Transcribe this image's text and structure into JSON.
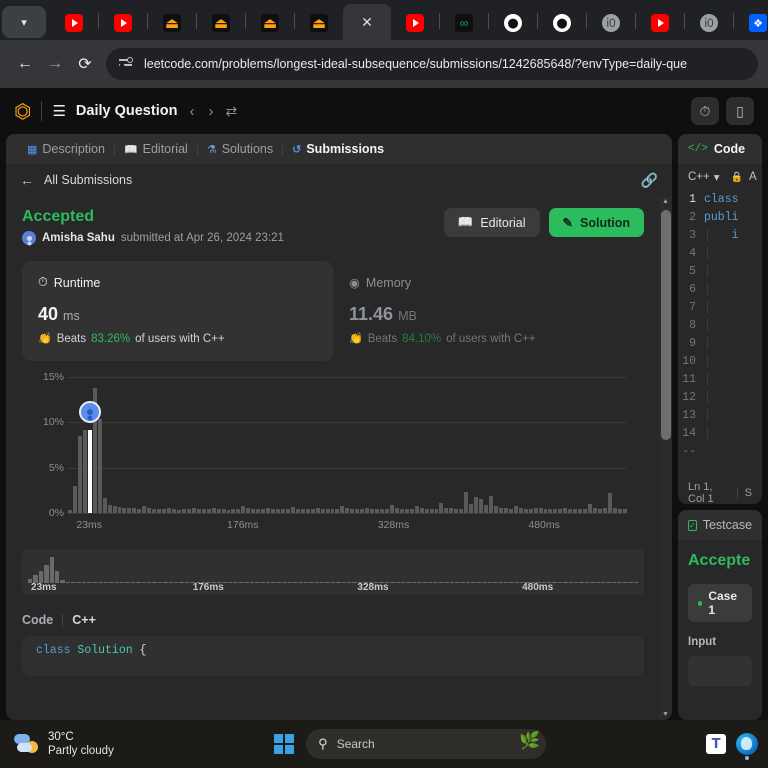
{
  "browser": {
    "tab_list_chevron_icon": "chevron-down-icon",
    "tabs": [
      {
        "favicon": "youtube-icon",
        "type": "yt",
        "active": false
      },
      {
        "favicon": "youtube-icon",
        "type": "yt",
        "active": false
      },
      {
        "favicon": "leetcode-icon",
        "type": "lc",
        "active": false
      },
      {
        "favicon": "leetcode-icon",
        "type": "lc",
        "active": false
      },
      {
        "favicon": "leetcode-icon",
        "type": "lc",
        "active": false
      },
      {
        "favicon": "leetcode-icon",
        "type": "lc",
        "active": false
      },
      {
        "favicon": "close-icon",
        "type": "active",
        "active": true
      },
      {
        "favicon": "youtube-icon",
        "type": "yt",
        "active": false
      },
      {
        "favicon": "mint-icon",
        "type": "teal",
        "active": false
      },
      {
        "favicon": "github-icon",
        "type": "gh",
        "active": false
      },
      {
        "favicon": "github-icon",
        "type": "gh",
        "active": false
      },
      {
        "favicon": "globe-icon",
        "type": "globe",
        "active": false
      },
      {
        "favicon": "youtube-icon",
        "type": "yt",
        "active": false
      },
      {
        "favicon": "globe-icon",
        "type": "globe",
        "active": false
      },
      {
        "favicon": "dropbox-icon",
        "type": "db",
        "active": false
      },
      {
        "favicon": "dropbox-icon",
        "type": "db",
        "active": false
      },
      {
        "favicon": "bolt-icon",
        "type": "bolt",
        "active": false
      },
      {
        "favicon": "google-icon",
        "type": "g",
        "active": false
      },
      {
        "favicon": "blue-bird-icon",
        "type": "blue",
        "active": false
      },
      {
        "favicon": "youtube-icon",
        "type": "yt",
        "active": false
      }
    ],
    "back_label": "back-arrow",
    "forward_label": "forward-arrow",
    "reload_label": "reload",
    "url": "leetcode.com/problems/longest-ideal-subsequence/submissions/1242685648/?envType=daily-que"
  },
  "lc_header": {
    "logo": "leetcode-logo",
    "list_icon": "problem-list-icon",
    "title": "Daily Question",
    "prev_icon": "chevron-left-icon",
    "next_icon": "chevron-right-icon",
    "shuffle_icon": "shuffle-icon",
    "timer_icon": "timer-icon",
    "notes_icon": "notes-icon"
  },
  "panel_tabs": [
    {
      "label": "Description",
      "icon": "description-icon",
      "active": false
    },
    {
      "label": "Editorial",
      "icon": "book-icon",
      "active": false
    },
    {
      "label": "Solutions",
      "icon": "flask-icon",
      "active": false
    },
    {
      "label": "Submissions",
      "icon": "history-icon",
      "active": true
    }
  ],
  "subhead": {
    "back_icon": "arrow-left-icon",
    "label": "All Submissions",
    "link_icon": "link-icon"
  },
  "submission": {
    "status": "Accepted",
    "avatar": "user-avatar",
    "user": "Amisha Sahu",
    "meta": "submitted at Apr 26, 2024 23:21",
    "editorial_button": "Editorial",
    "editorial_icon": "book-icon",
    "solution_button": "Solution",
    "solution_icon": "pencil-icon",
    "accent_green": "#2cbb5d"
  },
  "stats": {
    "runtime": {
      "title": "Runtime",
      "icon": "clock-icon",
      "value": "40",
      "unit": "ms",
      "beats_prefix": "Beats",
      "beats_pct": "83.26%",
      "beats_suffix": "of users with C++",
      "clap_icon": "clap-icon",
      "selected": true
    },
    "memory": {
      "title": "Memory",
      "icon": "memory-icon",
      "value": "11.46",
      "unit": "MB",
      "beats_prefix": "Beats",
      "beats_pct": "84.10%",
      "beats_suffix": "of users with C++",
      "clap_icon": "clap-icon",
      "selected": false
    }
  },
  "chart_data": {
    "type": "bar",
    "title": "",
    "xlabel": "",
    "ylabel": "",
    "ylim": [
      0,
      15
    ],
    "ytick_labels": [
      "0%",
      "5%",
      "10%",
      "15%"
    ],
    "ytick_values": [
      0,
      5,
      10,
      15
    ],
    "grid": true,
    "legend": "none",
    "xtick_labels": [
      "23ms",
      "176ms",
      "328ms",
      "480ms"
    ],
    "xtick_positions_pct": [
      1.5,
      28.5,
      55.5,
      82.5
    ],
    "highlight_index": 4,
    "highlight_color": "#ffffff",
    "bar_color": "#5a5a5a",
    "user_marker": {
      "icon": "user-marker-icon",
      "x_index": 4,
      "y_value": 11.1
    },
    "values": [
      0.3,
      3.0,
      8.5,
      9.2,
      9.2,
      13.8,
      10.4,
      1.7,
      0.9,
      0.75,
      0.65,
      0.6,
      0.5,
      0.55,
      0.45,
      0.8,
      0.5,
      0.45,
      0.4,
      0.42,
      0.5,
      0.4,
      0.38,
      0.42,
      0.4,
      0.5,
      0.45,
      0.42,
      0.4,
      0.55,
      0.42,
      0.4,
      0.38,
      0.42,
      0.45,
      0.75,
      0.5,
      0.45,
      0.42,
      0.4,
      0.5,
      0.42,
      0.45,
      0.4,
      0.42,
      0.65,
      0.45,
      0.4,
      0.42,
      0.4,
      0.55,
      0.42,
      0.4,
      0.45,
      0.42,
      0.8,
      0.5,
      0.45,
      0.42,
      0.4,
      0.6,
      0.48,
      0.42,
      0.45,
      0.4,
      0.9,
      0.55,
      0.45,
      0.42,
      0.4,
      0.75,
      0.5,
      0.45,
      0.42,
      0.4,
      1.1,
      0.6,
      0.5,
      0.45,
      0.42,
      2.3,
      1.0,
      1.8,
      1.5,
      0.9,
      1.9,
      0.8,
      0.55,
      0.5,
      0.45,
      0.75,
      0.5,
      0.45,
      0.42,
      0.5,
      0.6,
      0.45,
      0.42,
      0.4,
      0.45,
      0.5,
      0.42,
      0.4,
      0.45,
      0.42,
      1.0,
      0.55,
      0.45,
      0.6,
      2.2,
      0.5,
      0.42,
      0.4
    ]
  },
  "minimap": {
    "xtick_labels": [
      "23ms",
      "176ms",
      "328ms",
      "480ms"
    ],
    "xtick_positions_pct": [
      0.5,
      27,
      54,
      81
    ],
    "values": [
      4,
      8,
      12,
      18,
      26,
      12,
      3,
      1,
      1,
      1,
      1,
      1,
      1,
      1,
      1,
      1,
      1,
      1,
      1,
      1,
      1,
      1,
      1,
      1,
      1,
      1,
      1,
      1,
      1,
      1,
      1,
      1,
      1,
      1,
      1,
      1,
      1,
      1,
      1,
      1,
      1,
      1,
      1,
      1,
      1,
      1,
      1,
      1,
      1,
      1,
      1,
      1,
      1,
      1,
      1,
      1,
      1,
      1,
      1,
      1,
      1,
      1,
      1,
      1,
      1,
      1,
      1,
      1,
      1,
      1,
      1,
      1,
      1,
      1,
      1,
      1,
      1,
      1,
      1,
      1,
      1,
      1,
      1,
      1,
      1,
      1,
      1,
      1,
      1,
      1,
      1,
      1,
      1,
      1,
      1,
      1,
      1,
      1,
      1,
      1,
      1,
      1,
      1,
      1,
      1,
      1,
      1,
      1,
      1,
      1,
      1,
      1,
      1
    ],
    "max": 30
  },
  "code_section": {
    "label": "Code",
    "lang": "C++",
    "preview_line": "class Solution {"
  },
  "right_panel": {
    "code_tab_label": "Code",
    "code_tab_icon": "code-brackets-icon",
    "lang_select": "C++",
    "lang_chevron": "chevron-down-icon",
    "lock_icon": "lock-icon",
    "auto_label": "A",
    "gutter_lines": [
      "1",
      "2",
      "3",
      "4",
      "5",
      "6",
      "7",
      "8",
      "9",
      "10",
      "11",
      "12",
      "13",
      "14",
      "--"
    ],
    "code_lines": [
      "class",
      "publi",
      "    i",
      "",
      "",
      "",
      "",
      "",
      "",
      "",
      "",
      "",
      "",
      "",
      ""
    ],
    "status_line": "Ln 1, Col 1",
    "status_extra": "S",
    "testcase_tab_label": "Testcase",
    "testcase_tab_icon": "checkbox-icon",
    "test_result": "Accepte",
    "case_label": "Case 1",
    "input_label": "Input"
  },
  "scroll": {
    "up_arrow": "scroll-up-arrow",
    "down_arrow": "scroll-down-arrow"
  },
  "taskbar": {
    "weather_temp": "30°C",
    "weather_desc": "Partly cloudy",
    "weather_icon": "partly-cloudy-icon",
    "start_icon": "windows-start-icon",
    "search_icon": "search-icon",
    "search_placeholder": "Search",
    "search_decor_icon": "mimosa-icon",
    "teams_icon": "teams-icon",
    "edge_icon": "edge-icon"
  }
}
